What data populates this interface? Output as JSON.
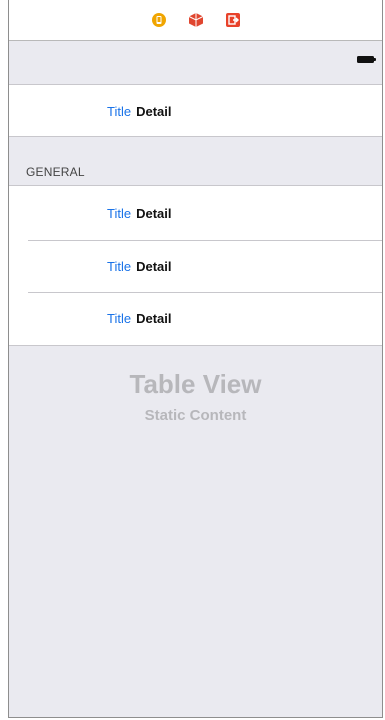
{
  "dock": {
    "icons": [
      "view-controller-icon",
      "first-responder-icon",
      "exit-icon"
    ],
    "colors": {
      "controller": "#f0a500",
      "responder": "#e0462f",
      "exit": "#e8422a"
    }
  },
  "status_bar": {
    "battery_icon": "battery-icon"
  },
  "sections": [
    {
      "header": "",
      "cells": [
        {
          "title": "Title",
          "detail": "Detail"
        }
      ]
    },
    {
      "header": "GENERAL",
      "cells": [
        {
          "title": "Title",
          "detail": "Detail"
        },
        {
          "title": "Title",
          "detail": "Detail"
        },
        {
          "title": "Title",
          "detail": "Detail"
        }
      ]
    }
  ],
  "placeholder": {
    "title": "Table View",
    "subtitle": "Static Content"
  },
  "colors": {
    "title_blue": "#1a73e8",
    "group_background": "#eaeaf0",
    "separator": "#c8c7cc"
  }
}
